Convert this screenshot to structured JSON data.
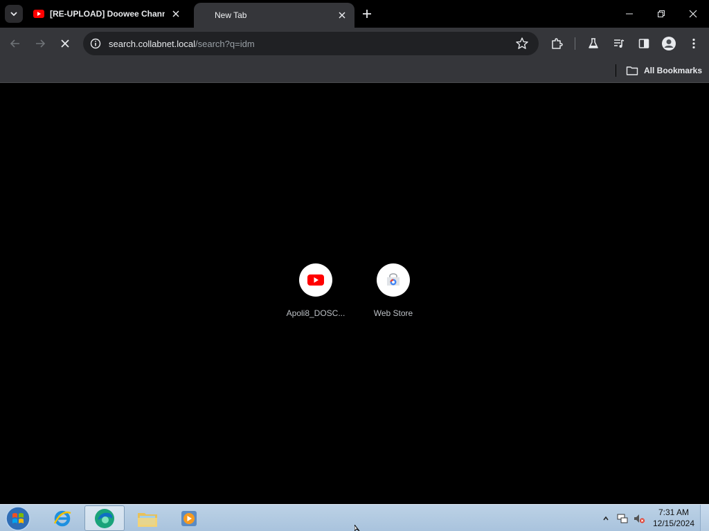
{
  "tabs": [
    {
      "title": "[RE-UPLOAD] Doowee Channel",
      "favicon": "youtube-icon",
      "active": false
    },
    {
      "title": "New Tab",
      "favicon": "",
      "active": true
    }
  ],
  "toolbar": {
    "url_host": "search.collabnet.local",
    "url_path": "/search?q=idm"
  },
  "bookmarks": {
    "all_bookmarks_label": "All Bookmarks"
  },
  "shortcuts": [
    {
      "label": "Apoli8_DOSC...",
      "icon": "youtube-icon"
    },
    {
      "label": "Web Store",
      "icon": "web-store-icon"
    }
  ],
  "taskbar": {
    "time": "7:31 AM",
    "date": "12/15/2024"
  },
  "colors": {
    "youtube_red": "#ff0000",
    "chrome_toolbar": "#35363a",
    "taskbar": "#b3cae2"
  }
}
